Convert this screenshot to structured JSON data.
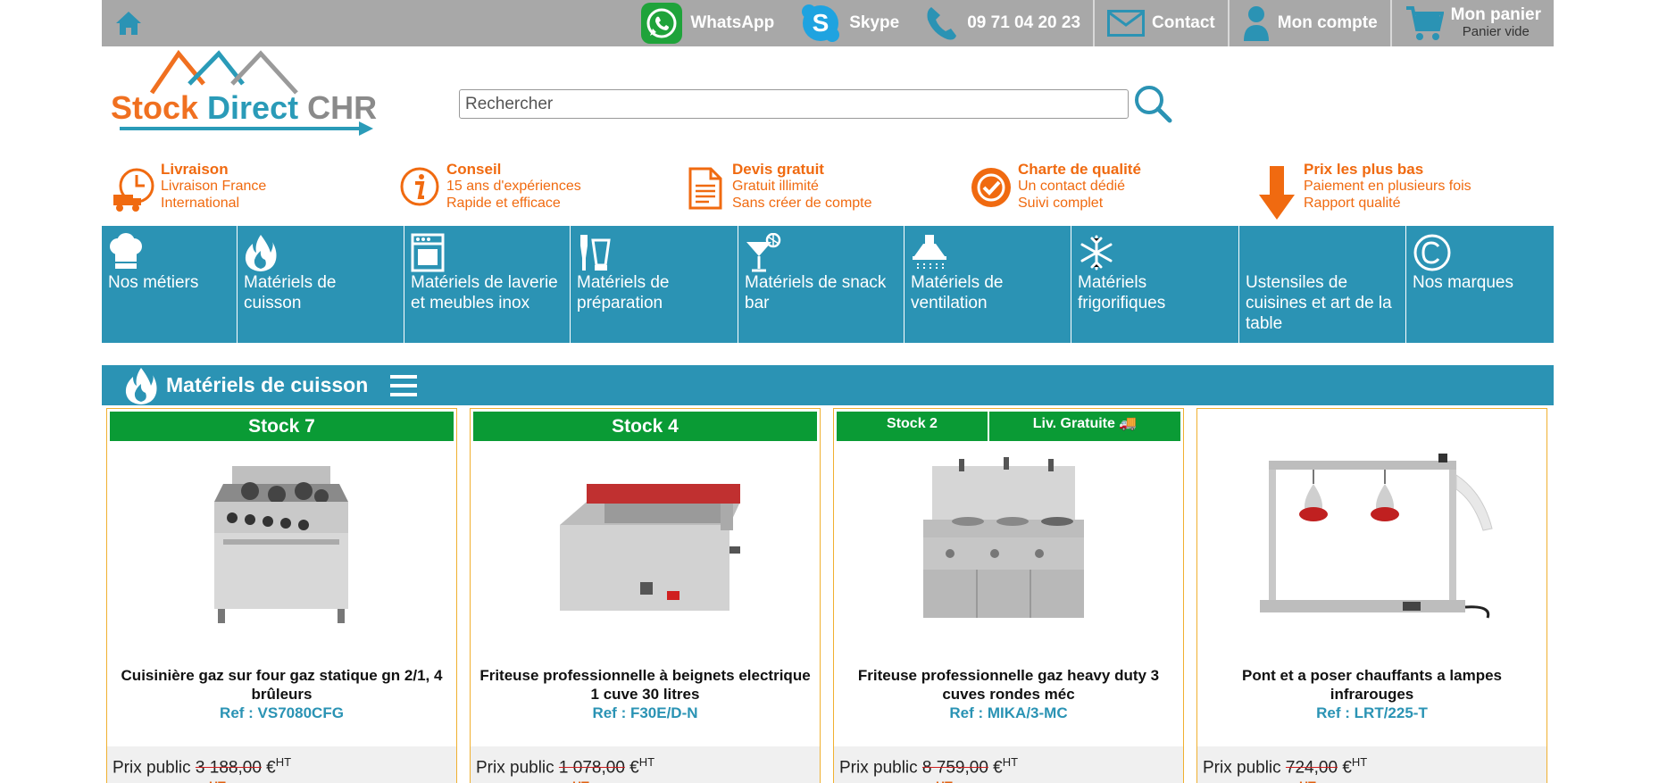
{
  "topbar": {
    "whatsapp": "WhatsApp",
    "skype": "Skype",
    "phone": "09 71 04 20 23",
    "contact": "Contact",
    "account": "Mon compte",
    "cart_title": "Mon panier",
    "cart_status": "Panier vide"
  },
  "logo": {
    "part1": "Stock ",
    "part2": "Direct ",
    "part3": "CHR"
  },
  "search": {
    "placeholder": "Rechercher",
    "value": ""
  },
  "features": [
    {
      "title": "Livraison",
      "line1": "Livraison France",
      "line2": "International",
      "icon": "delivery-clock-icon"
    },
    {
      "title": "Conseil",
      "line1": "15 ans d'expériences",
      "line2": "Rapide et efficace",
      "icon": "info-icon"
    },
    {
      "title": "Devis gratuit",
      "line1": "Gratuit illimité",
      "line2": "Sans créer de compte",
      "icon": "document-icon"
    },
    {
      "title": "Charte de qualité",
      "line1": "Un contact dédié",
      "line2": "Suivi complet",
      "icon": "quality-seal-icon"
    },
    {
      "title": "Prix les plus bas",
      "line1": "Paiement en plusieurs fois",
      "line2": "Rapport qualité",
      "icon": "down-arrow-icon"
    }
  ],
  "categories": [
    {
      "label": "Nos métiers",
      "icon": "chef-hat-icon"
    },
    {
      "label": "Matériels de cuisson",
      "icon": "flame-icon"
    },
    {
      "label": "Matériels de laverie et meubles inox",
      "icon": "dishwasher-icon"
    },
    {
      "label": "Matériels de préparation",
      "icon": "mixer-icon"
    },
    {
      "label": "Matériels de snack bar",
      "icon": "cocktail-icon"
    },
    {
      "label": "Matériels de ventilation",
      "icon": "hood-icon"
    },
    {
      "label": "Matériels frigorifiques",
      "icon": "snowflake-icon"
    },
    {
      "label": "Ustensiles de cuisines et art de la table",
      "icon": ""
    },
    {
      "label": "Nos marques",
      "icon": "copyright-icon"
    }
  ],
  "section": {
    "title": "Matériels de cuisson"
  },
  "products": [
    {
      "badge": "Stock 7",
      "name": "Cuisinière gaz sur four gaz statique gn 2/1, 4 brûleurs",
      "ref": "Ref : VS7080CFG",
      "price_label": "Prix public ",
      "price": "3 188,00",
      "currency": " €",
      "tax": "HT",
      "extra": "HT"
    },
    {
      "badge": "Stock 4",
      "name": "Friteuse professionnelle à beignets electrique 1 cuve 30 litres",
      "ref": "Ref : F30E/D-N",
      "price_label": "Prix public ",
      "price": "1 078,00",
      "currency": " €",
      "tax": "HT",
      "extra": "HT"
    },
    {
      "badge": "Stock 2",
      "badge2": "Liv. Gratuite 🚚",
      "name": "Friteuse professionnelle gaz heavy duty 3 cuves rondes méc",
      "ref": "Ref : MIKA/3-MC",
      "price_label": "Prix public ",
      "price": "8 759,00",
      "currency": " €",
      "tax": "HT",
      "extra": "HT"
    },
    {
      "badge": "",
      "name": "Pont et a poser chauffants a lampes infrarouges",
      "ref": "Ref : LRT/225-T",
      "price_label": "Prix public ",
      "price": "724,00",
      "currency": " €",
      "tax": "HT",
      "extra": "HT"
    }
  ],
  "colors": {
    "primary": "#2b93b4",
    "orange": "#f06a10",
    "stock_green": "#0a9b35",
    "topbar": "#a8a8a8"
  }
}
